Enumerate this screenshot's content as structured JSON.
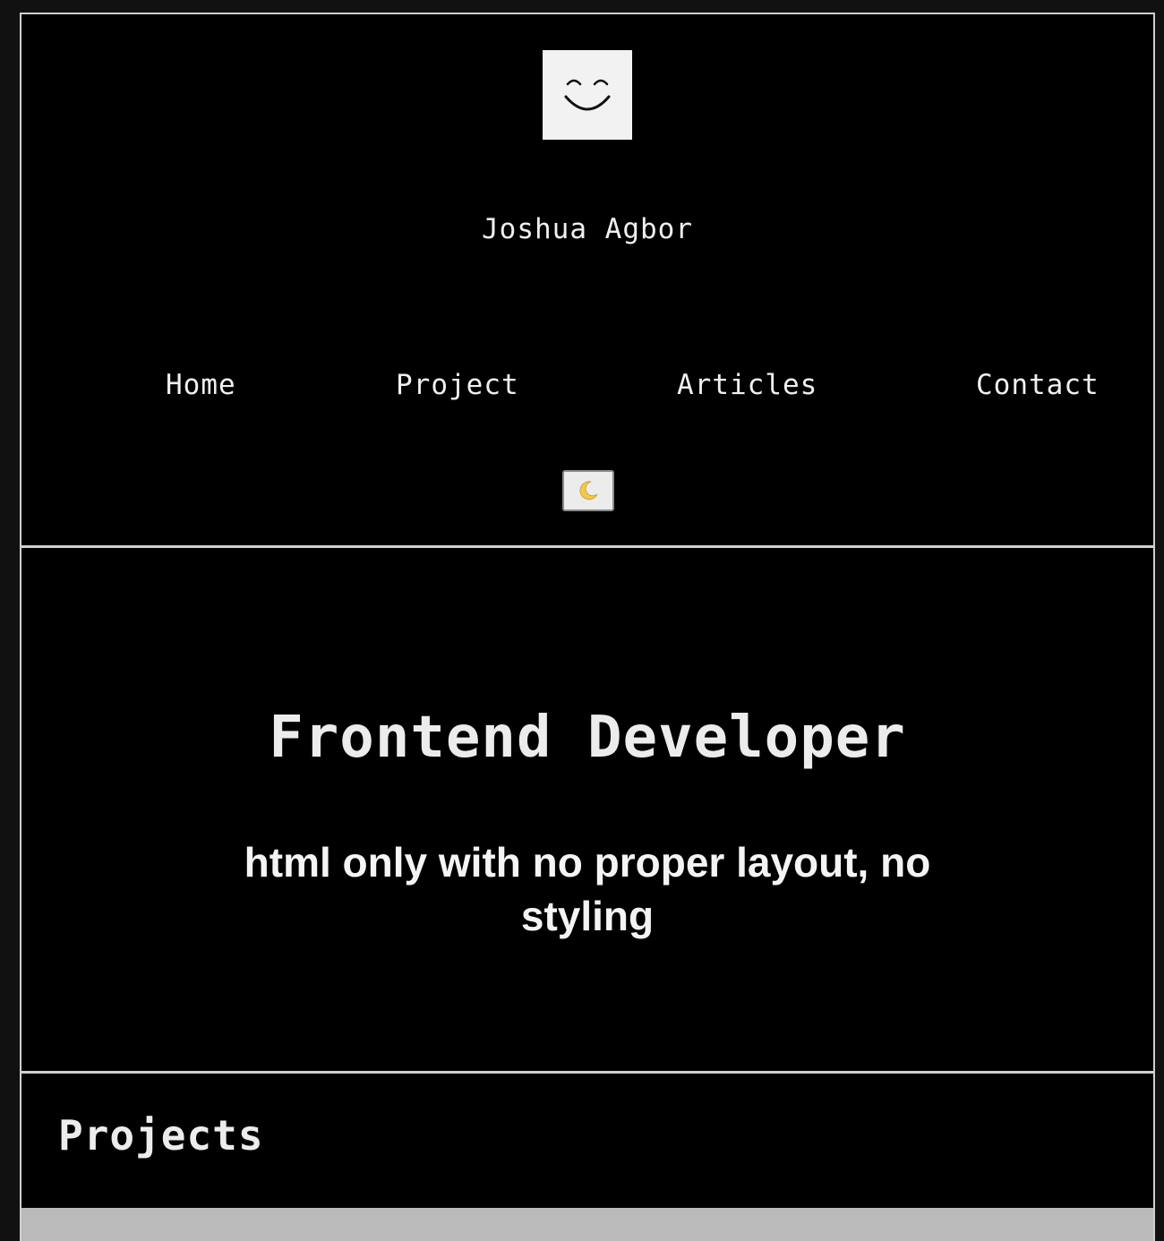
{
  "header": {
    "logo_icon": "smiley-face-icon",
    "site_name": "Joshua Agbor",
    "nav": [
      {
        "label": "Home"
      },
      {
        "label": "Project"
      },
      {
        "label": "Articles"
      },
      {
        "label": "Contact"
      }
    ],
    "theme_toggle_icon": "crescent-moon-icon"
  },
  "hero": {
    "title": "Frontend Developer",
    "subtitle": "html only with no proper layout, no styling"
  },
  "projects": {
    "title": "Projects"
  },
  "colors": {
    "background": "#000000",
    "text": "#f0f0f0",
    "border": "#cfcfcf",
    "logo_bg": "#f2f2f2",
    "moon": "#f2c94c",
    "projects_bar": "#bababa"
  }
}
